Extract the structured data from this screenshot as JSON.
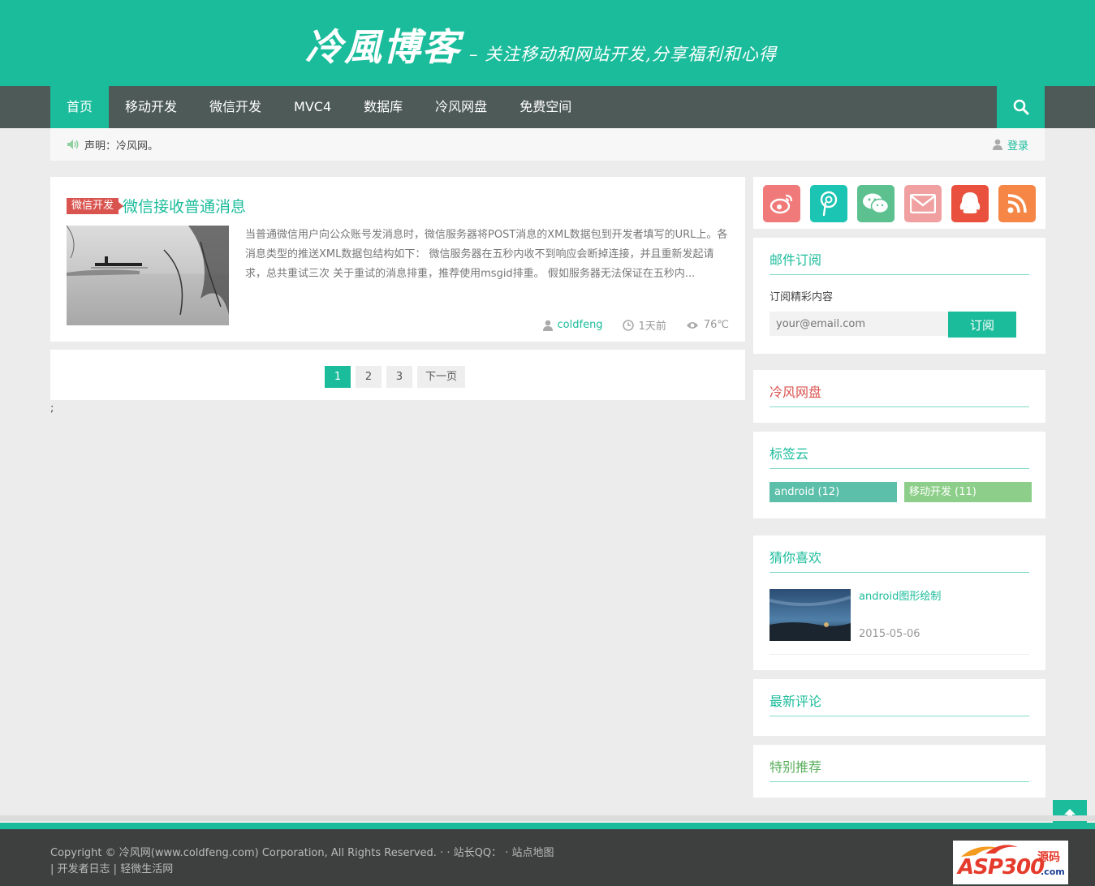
{
  "header": {
    "logo_main": "冷風博客",
    "logo_sub": "– 关注移动和网站开发,分享福利和心得"
  },
  "nav": {
    "items": [
      {
        "label": "首页",
        "active": true
      },
      {
        "label": "移动开发"
      },
      {
        "label": "微信开发"
      },
      {
        "label": "MVC4"
      },
      {
        "label": "数据库"
      },
      {
        "label": "冷风网盘"
      },
      {
        "label": "免费空间"
      }
    ],
    "search_icon": "search-icon"
  },
  "notice": {
    "text": "声明：冷风网。",
    "login": "登录"
  },
  "article": {
    "category": "微信开发",
    "title": "微信接收普通消息",
    "excerpt": "当普通微信用户向公众账号发消息时，微信服务器将POST消息的XML数据包到开发者填写的URL上。各消息类型的推送XML数据包结构如下： 微信服务器在五秒内收不到响应会断掉连接，并且重新发起请求，总共重试三次 关于重试的消息排重，推荐使用msgid排重。 假如服务器无法保证在五秒内...",
    "author": "coldfeng",
    "time": "1天前",
    "views": "76℃"
  },
  "pagination": {
    "pages": [
      "1",
      "2",
      "3"
    ],
    "current": "1",
    "next": "下一页"
  },
  "stray_text": ";",
  "sidebar": {
    "social": [
      {
        "name": "weibo-icon",
        "color": "#f07a7a"
      },
      {
        "name": "podcast-icon",
        "color": "#1bc4b3"
      },
      {
        "name": "wechat-icon",
        "color": "#5cc08f"
      },
      {
        "name": "mail-icon",
        "color": "#f0a0a0"
      },
      {
        "name": "qq-icon",
        "color": "#e9503d"
      },
      {
        "name": "rss-icon",
        "color": "#f58646"
      }
    ],
    "subscribe": {
      "title": "邮件订阅",
      "label": "订阅精彩内容",
      "placeholder": "your@email.com",
      "button": "订阅"
    },
    "netdisk": {
      "title": "冷风网盘"
    },
    "tags": {
      "title": "标签云",
      "items": [
        {
          "label": "android (12)",
          "color": "#5bbfa9"
        },
        {
          "label": "移动开发 (11)",
          "color": "#8dcf8a"
        }
      ]
    },
    "guess": {
      "title": "猜你喜欢",
      "item_title": "android图形绘制",
      "item_date": "2015-05-06"
    },
    "comments": {
      "title": "最新评论"
    },
    "recommend": {
      "title": "特别推荐"
    }
  },
  "footer": {
    "copyright": "Copyright © 冷风网(www.coldfeng.com) Corporation, All Rights Reserved.",
    "sep1": " · · ",
    "qq": "站长QQ：",
    "sep2": " · ",
    "sitemap": "站点地图",
    "links": [
      "开发者日志",
      "轻微生活网"
    ],
    "badge_text": "ASP300",
    "badge_sub": "源码",
    "badge_com": ".com"
  },
  "colors": {
    "accent": "#1bbc9b",
    "nav_bg": "#4d5a57",
    "tag_red": "#d9534f",
    "footer_bg": "#3e3f3f"
  }
}
